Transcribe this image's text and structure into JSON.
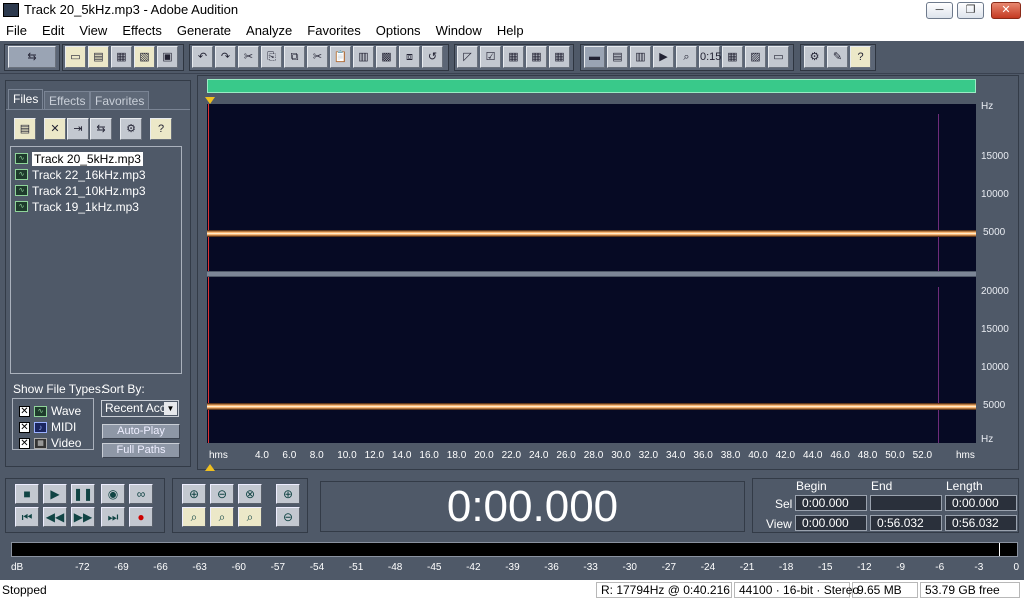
{
  "window": {
    "title": "Track 20_5kHz.mp3 - Adobe Audition",
    "min": "─",
    "max": "❐",
    "close": "✕"
  },
  "menu": [
    "File",
    "Edit",
    "View",
    "Effects",
    "Generate",
    "Analyze",
    "Favorites",
    "Options",
    "Window",
    "Help"
  ],
  "panel": {
    "tabs": [
      "Files",
      "Effects",
      "Favorites"
    ],
    "files": [
      "Track 20_5kHz.mp3",
      "Track 22_16kHz.mp3",
      "Track 21_10kHz.mp3",
      "Track 19_1kHz.mp3"
    ],
    "show_file_types_label": "Show File Types:",
    "sort_by_label": "Sort By:",
    "types": [
      "Wave",
      "MIDI",
      "Video"
    ],
    "sort_value": "Recent Acc",
    "autoplay": "Auto-Play",
    "fullpaths": "Full Paths"
  },
  "spectrum": {
    "top_labels": [
      "Hz",
      "15000",
      "10000",
      "5000"
    ],
    "bottom_labels": [
      "20000",
      "15000",
      "10000",
      "5000",
      "Hz"
    ]
  },
  "ruler": {
    "start": "hms",
    "end": "hms",
    "ticks": [
      "4.0",
      "6.0",
      "8.0",
      "10.0",
      "12.0",
      "14.0",
      "16.0",
      "18.0",
      "20.0",
      "22.0",
      "24.0",
      "26.0",
      "28.0",
      "30.0",
      "32.0",
      "34.0",
      "36.0",
      "38.0",
      "40.0",
      "42.0",
      "44.0",
      "46.0",
      "48.0",
      "50.0",
      "52.0"
    ]
  },
  "transport": {
    "time": "0:00.000",
    "begin_label": "Begin",
    "end_label": "End",
    "length_label": "Length",
    "sel_label": "Sel",
    "view_label": "View",
    "sel_begin": "0:00.000",
    "sel_end": "",
    "sel_length": "0:00.000",
    "view_begin": "0:00.000",
    "view_end": "0:56.032",
    "view_length": "0:56.032"
  },
  "meter": {
    "ticks": [
      "dB",
      "-72",
      "-69",
      "-66",
      "-63",
      "-60",
      "-57",
      "-54",
      "-51",
      "-48",
      "-45",
      "-42",
      "-39",
      "-36",
      "-33",
      "-30",
      "-27",
      "-24",
      "-21",
      "-18",
      "-15",
      "-12",
      "-9",
      "-6",
      "-3",
      "0"
    ]
  },
  "status": {
    "state": "Stopped",
    "readout": "R: 17794Hz @   0:40.216",
    "format": "44100 · 16-bit · Stereo",
    "size": "9.65 MB",
    "free": "53.79 GB free"
  },
  "colors": {
    "accent": "#39c98a",
    "band": "#ffb56a",
    "background": "#4f5968"
  }
}
